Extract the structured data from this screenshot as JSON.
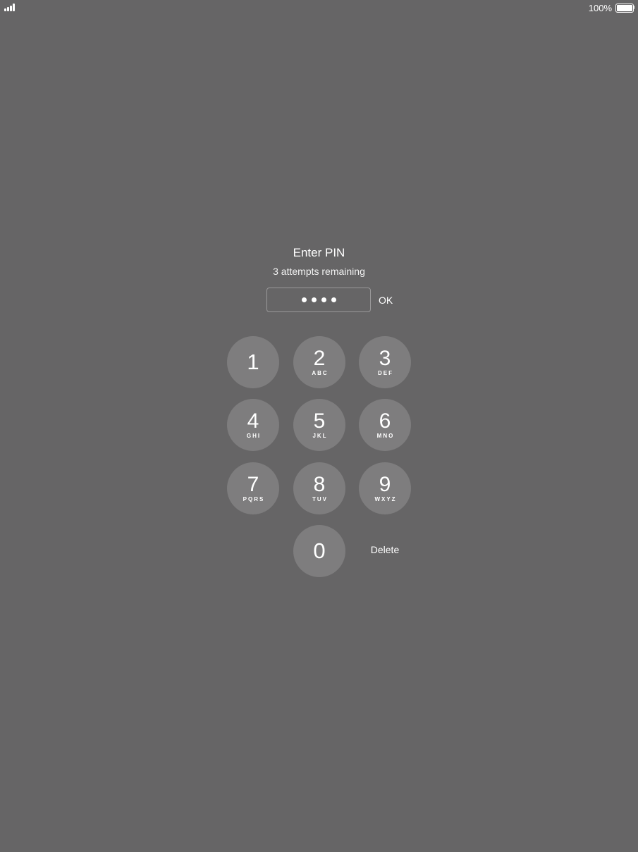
{
  "status_bar": {
    "signal_icon": "cellular-signal-icon",
    "battery_text": "100%",
    "battery_icon": "battery-full-icon",
    "battery_level": 1.0
  },
  "pin_prompt": {
    "title": "Enter PIN",
    "subtitle": "3 attempts remaining",
    "entered_digits": 4,
    "masked_value": "••••",
    "ok_label": "OK"
  },
  "keypad": {
    "keys": [
      {
        "digit": "1",
        "letters": ""
      },
      {
        "digit": "2",
        "letters": "ABC"
      },
      {
        "digit": "3",
        "letters": "DEF"
      },
      {
        "digit": "4",
        "letters": "GHI"
      },
      {
        "digit": "5",
        "letters": "JKL"
      },
      {
        "digit": "6",
        "letters": "MNO"
      },
      {
        "digit": "7",
        "letters": "PQRS"
      },
      {
        "digit": "8",
        "letters": "TUV"
      },
      {
        "digit": "9",
        "letters": "WXYZ"
      },
      {
        "digit": "0",
        "letters": ""
      }
    ],
    "delete_label": "Delete"
  },
  "colors": {
    "background": "#666566",
    "text": "#ffffff",
    "key_fill": "rgba(255,255,255,0.16)",
    "field_border": "#9a999a"
  }
}
